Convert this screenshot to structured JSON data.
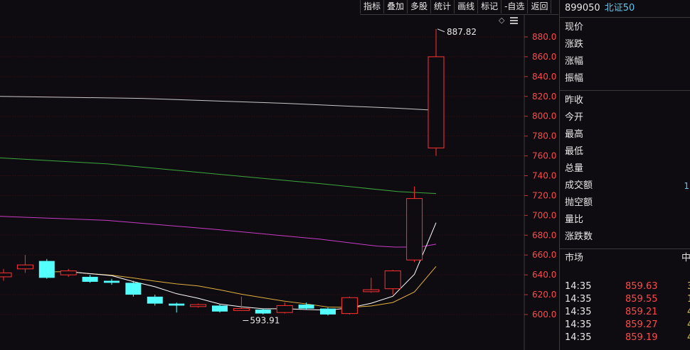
{
  "toolbar": {
    "items": [
      "指标",
      "叠加",
      "多股",
      "统计",
      "画线",
      "标记",
      "-自选",
      "返回"
    ]
  },
  "chart_data": {
    "type": "candlestick",
    "y_ticks": [
      "880.0",
      "860.0",
      "840.0",
      "820.0",
      "800.0",
      "780.0",
      "760.0",
      "740.0",
      "720.0",
      "700.0",
      "680.0",
      "660.0",
      "640.0",
      "620.0",
      "600.0"
    ],
    "ylim": [
      590,
      895
    ],
    "candles": [
      {
        "o": 638,
        "c": 642,
        "h": 646,
        "l": 634
      },
      {
        "o": 646,
        "c": 650,
        "h": 660,
        "l": 642
      },
      {
        "o": 654,
        "c": 637,
        "h": 656,
        "l": 636
      },
      {
        "o": 640,
        "c": 644,
        "h": 646,
        "l": 638
      },
      {
        "o": 638,
        "c": 633,
        "h": 640,
        "l": 632
      },
      {
        "o": 634,
        "c": 632,
        "h": 636,
        "l": 630
      },
      {
        "o": 632,
        "c": 620,
        "h": 634,
        "l": 618
      },
      {
        "o": 618,
        "c": 611,
        "h": 620,
        "l": 609
      },
      {
        "o": 611,
        "c": 609,
        "h": 612,
        "l": 602
      },
      {
        "o": 608,
        "c": 610,
        "h": 611,
        "l": 607
      },
      {
        "o": 609,
        "c": 603,
        "h": 610,
        "l": 602
      },
      {
        "o": 604,
        "c": 606,
        "h": 618,
        "l": 604
      },
      {
        "o": 605,
        "c": 601,
        "h": 606,
        "l": 600
      },
      {
        "o": 602,
        "c": 609,
        "h": 612,
        "l": 601
      },
      {
        "o": 610,
        "c": 606,
        "h": 612,
        "l": 605
      },
      {
        "o": 606,
        "c": 600,
        "h": 607,
        "l": 599
      },
      {
        "o": 601,
        "c": 617,
        "h": 618,
        "l": 600
      },
      {
        "o": 623,
        "c": 625,
        "h": 637,
        "l": 622
      },
      {
        "o": 626,
        "c": 644,
        "h": 645,
        "l": 620
      },
      {
        "o": 655,
        "c": 717,
        "h": 729,
        "l": 653
      },
      {
        "o": 768,
        "c": 860,
        "h": 888,
        "l": 760
      }
    ],
    "annotations": {
      "high_label": "887.82",
      "low_label": "593.91"
    }
  },
  "panel": {
    "code": "899050",
    "name": "北证50",
    "quote_labels": [
      "现价",
      "涨跌",
      "涨幅",
      "振幅"
    ],
    "price_labels": [
      "昨收",
      "今开",
      "最高",
      "最低",
      "总量",
      "成交额",
      "抛空额",
      "量比",
      "涨跌数"
    ],
    "turnover_partial": "1",
    "tick_header": {
      "left": "市场",
      "right": "中"
    },
    "ticks": [
      {
        "time": "14:35",
        "price": "859.63",
        "vol": "3"
      },
      {
        "time": "14:35",
        "price": "859.55",
        "vol": "1"
      },
      {
        "time": "14:35",
        "price": "859.21",
        "vol": "4"
      },
      {
        "time": "14:35",
        "price": "859.27",
        "vol": "4"
      },
      {
        "time": "14:35",
        "price": "859.19",
        "vol": "4"
      }
    ]
  }
}
